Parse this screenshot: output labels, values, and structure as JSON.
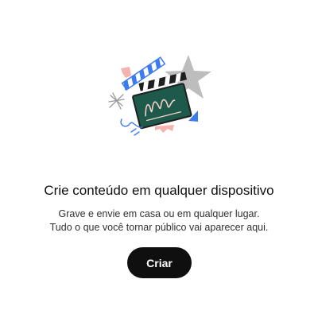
{
  "empty_state": {
    "illustration_icon": "clapperboard-illustration-icon",
    "title": "Crie conteúdo em qualquer dispositivo",
    "subtitle_line1": "Grave e envie em casa ou em qualquer lugar.",
    "subtitle_line2": "Tudo o que você tornar público vai aparecer aqui.",
    "create_button_label": "Criar"
  },
  "colors": {
    "background": "#ffffff",
    "button_background": "#0f0f0f",
    "button_text": "#ffffff",
    "clapper_green": "#1e5a4b",
    "accent_blue": "#3d7bf0",
    "accent_pink": "#f4b3ae",
    "star_gray": "#b8b8b8"
  }
}
